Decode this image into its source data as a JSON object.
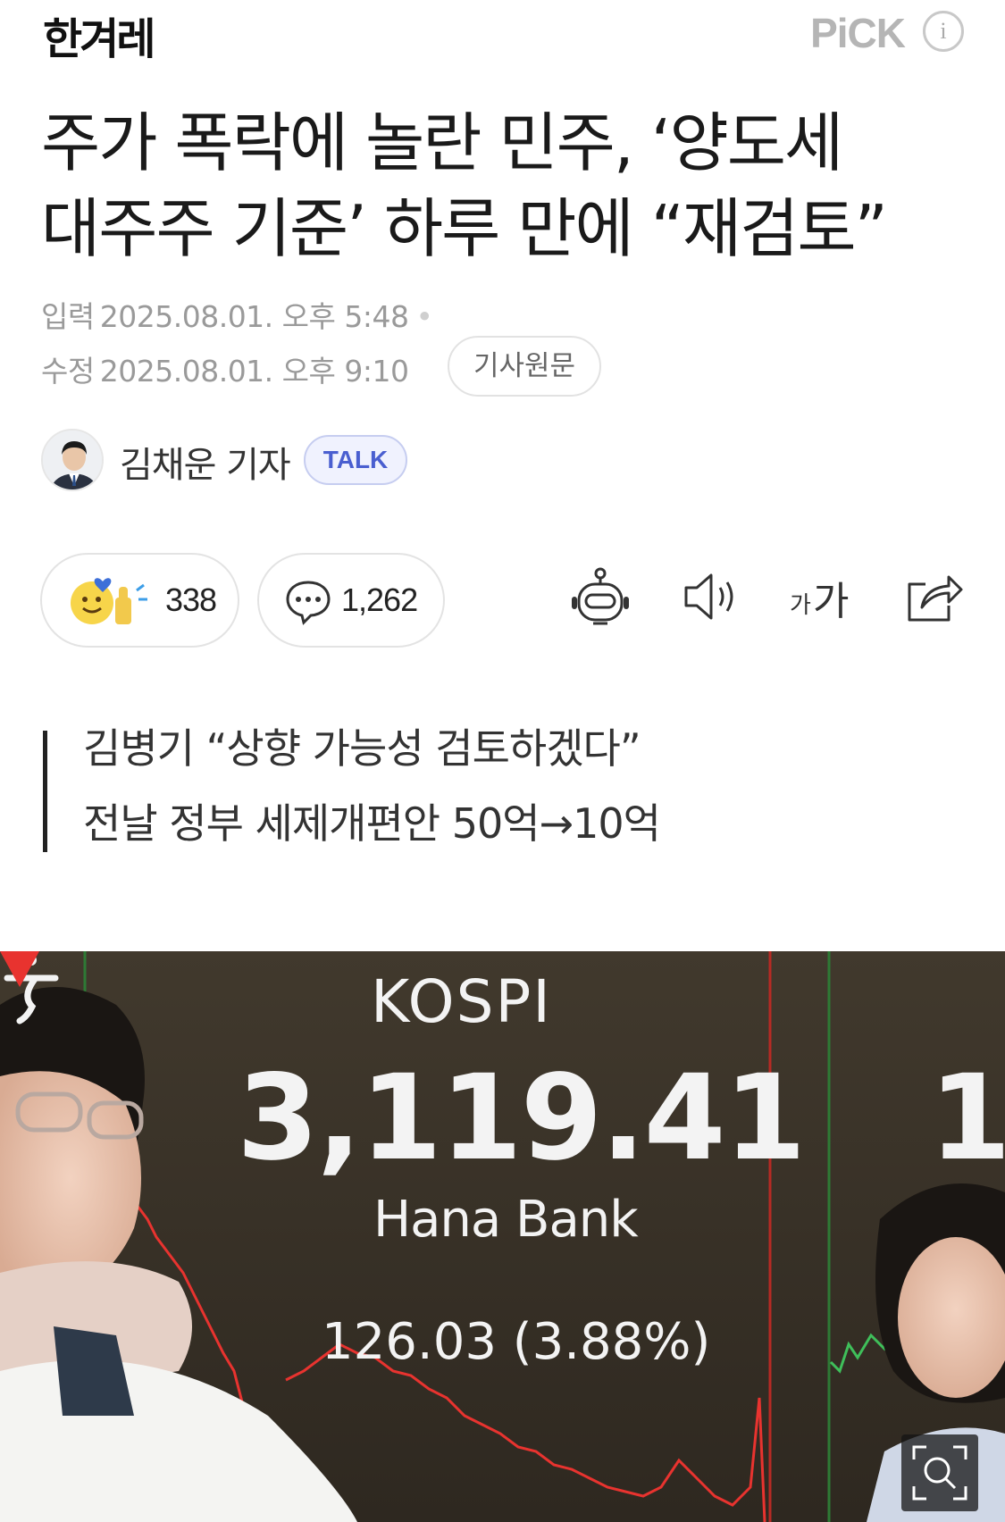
{
  "header": {
    "press_logo": "한겨레",
    "pick_label": "PiCK",
    "info_icon": "info-icon"
  },
  "article": {
    "headline_line1": "주가 폭락에 놀란 민주, ‘양도세",
    "headline_line2": "대주주 기준’ 하루 만에 “재검토”",
    "input_label": "입력",
    "input_time": "2025.08.01. 오후 5:48",
    "modified_label": "수정",
    "modified_time": "2025.08.01. 오후 9:10",
    "origin_button": "기사원문",
    "author_name": "김채운 기자",
    "talk_button": "TALK"
  },
  "actions": {
    "reaction_count": "338",
    "comment_count": "1,262",
    "icons": [
      "reaction-icon",
      "comment-icon",
      "summary-bot-icon",
      "tts-speaker-icon",
      "font-size-icon",
      "share-icon"
    ]
  },
  "summary": {
    "line1": "김병기 “상향 가능성 검토하겠다”",
    "line2": "전날 정부 세제개편안 50억→10억"
  },
  "photo": {
    "board_title": "KOSPI",
    "board_value": "3,119.41",
    "board_value_partial": "1",
    "board_bank": "Hana Bank",
    "board_change": "126.03 (3.88%)",
    "accent_down": "#e8332f",
    "accent_up": "#3fbf5a"
  }
}
